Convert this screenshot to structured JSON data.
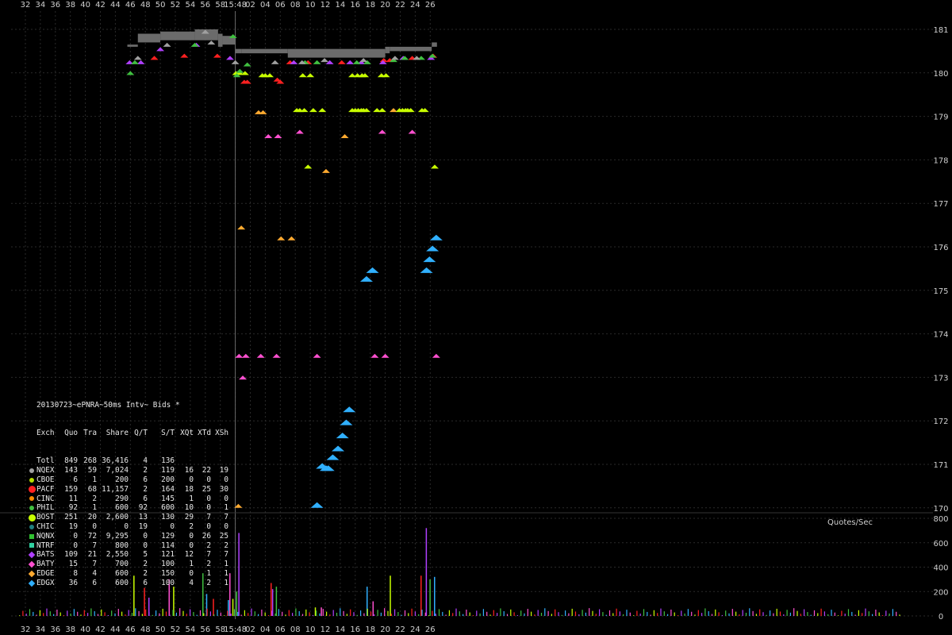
{
  "chart_data": {
    "type": "scatter",
    "x_ticks": [
      "32",
      "34",
      "36",
      "38",
      "40",
      "42",
      "44",
      "46",
      "48",
      "50",
      "52",
      "54",
      "56",
      "58",
      "15:48",
      "02",
      "04",
      "06",
      "08",
      "10",
      "12",
      "14",
      "16",
      "18",
      "20",
      "22",
      "24",
      "26"
    ],
    "y_ticks": [
      "181",
      "180",
      "179",
      "178",
      "177",
      "176",
      "175",
      "174",
      "173",
      "172",
      "171",
      "170"
    ],
    "ylim": [
      170,
      181
    ],
    "volume_ticks": [
      "800",
      "600",
      "400",
      "200",
      "0"
    ],
    "volume_label": "Quotes/Sec",
    "legend_title": "20130723~ePNRA~50ms Intv~ Bids *",
    "legend_header": [
      "Exch",
      "Quo",
      "Tra",
      "Share",
      "Q/T",
      "S/T",
      "XQt",
      "XTd",
      "XSh"
    ],
    "legend_rows": [
      {
        "name": "Totl",
        "cells": [
          "849",
          "268",
          "36,416",
          "4",
          "136",
          "",
          "",
          ""
        ],
        "color": ""
      },
      {
        "name": "NQEX",
        "cells": [
          "143",
          "59",
          "7,024",
          "2",
          "119",
          "16",
          "22",
          "19"
        ],
        "color": "#a0a0a0"
      },
      {
        "name": "CBOE",
        "cells": [
          "6",
          "1",
          "200",
          "6",
          "200",
          "0",
          "0",
          "0"
        ],
        "color": "#b8e000"
      },
      {
        "name": "PACF",
        "cells": [
          "159",
          "68",
          "11,157",
          "2",
          "164",
          "18",
          "25",
          "30"
        ],
        "color": "#ff2020"
      },
      {
        "name": "CINC",
        "cells": [
          "11",
          "2",
          "290",
          "6",
          "145",
          "1",
          "0",
          "0"
        ],
        "color": "#ff8c00"
      },
      {
        "name": "PHIL",
        "cells": [
          "92",
          "1",
          "600",
          "92",
          "600",
          "10",
          "0",
          "1"
        ],
        "color": "#40c040"
      },
      {
        "name": "BOST",
        "cells": [
          "251",
          "20",
          "2,600",
          "13",
          "130",
          "29",
          "7",
          "7"
        ],
        "color": "#c8ff00"
      },
      {
        "name": "CHIC",
        "cells": [
          "19",
          "0",
          "0",
          "19",
          "0",
          "2",
          "0",
          "0"
        ],
        "color": "#208080"
      },
      {
        "name": "NQNX",
        "cells": [
          "0",
          "72",
          "9,295",
          "0",
          "129",
          "0",
          "26",
          "25"
        ],
        "color": "#30c030"
      },
      {
        "name": "NTRF",
        "cells": [
          "0",
          "7",
          "800",
          "0",
          "114",
          "0",
          "2",
          "2"
        ],
        "color": "#30d0a0"
      },
      {
        "name": "BATS",
        "cells": [
          "109",
          "21",
          "2,550",
          "5",
          "121",
          "12",
          "7",
          "7"
        ],
        "color": "#b040ff"
      },
      {
        "name": "BATY",
        "cells": [
          "15",
          "7",
          "700",
          "2",
          "100",
          "1",
          "2",
          "1"
        ],
        "color": "#ff50d0"
      },
      {
        "name": "EDGE",
        "cells": [
          "8",
          "4",
          "600",
          "2",
          "150",
          "0",
          "1",
          "1"
        ],
        "color": "#ffaa30"
      },
      {
        "name": "EDGX",
        "cells": [
          "36",
          "6",
          "600",
          "6",
          "100",
          "4",
          "2",
          "1"
        ],
        "color": "#30b0ff"
      }
    ],
    "series": [
      {
        "name": "EDGX",
        "color": "#30b0ff",
        "points": [
          [
            10.9,
            170.0
          ],
          [
            11.6,
            170.9
          ],
          [
            12.1,
            170.85
          ],
          [
            12.4,
            170.85
          ],
          [
            13.0,
            171.1
          ],
          [
            13.7,
            171.3
          ],
          [
            14.3,
            171.6
          ],
          [
            14.8,
            171.9
          ],
          [
            15.2,
            172.2
          ],
          [
            17.5,
            175.2
          ],
          [
            18.3,
            175.4
          ],
          [
            25.5,
            175.4
          ],
          [
            25.9,
            175.65
          ],
          [
            26.3,
            175.9
          ],
          [
            26.8,
            176.15
          ]
        ]
      },
      {
        "name": "EDGE",
        "color": "#ffaa30",
        "points": [
          [
            0.4,
            170.0
          ],
          [
            0.8,
            176.4
          ],
          [
            6.1,
            176.15
          ],
          [
            7.5,
            176.15
          ],
          [
            12.1,
            177.7
          ],
          [
            14.6,
            178.5
          ],
          [
            3.1,
            179.05
          ],
          [
            3.7,
            179.05
          ],
          [
            21.1,
            179.1
          ]
        ]
      },
      {
        "name": "BATY",
        "color": "#ff50d0",
        "points": [
          [
            0.5,
            173.45
          ],
          [
            1.4,
            173.45
          ],
          [
            3.4,
            173.45
          ],
          [
            5.5,
            173.45
          ],
          [
            10.9,
            173.45
          ],
          [
            18.6,
            173.45
          ],
          [
            20.0,
            173.45
          ],
          [
            26.8,
            173.45
          ],
          [
            1.0,
            172.95
          ],
          [
            4.4,
            178.5
          ],
          [
            5.7,
            178.5
          ],
          [
            8.6,
            178.6
          ],
          [
            19.6,
            178.6
          ],
          [
            23.6,
            178.6
          ]
        ]
      },
      {
        "name": "BOST",
        "color": "#c8ff00",
        "points": [
          [
            9.7,
            177.8
          ],
          [
            26.6,
            177.8
          ],
          [
            8.2,
            179.1
          ],
          [
            8.6,
            179.1
          ],
          [
            9.2,
            179.1
          ],
          [
            10.4,
            179.1
          ],
          [
            11.6,
            179.1
          ],
          [
            15.6,
            179.1
          ],
          [
            16.0,
            179.1
          ],
          [
            16.4,
            179.1
          ],
          [
            16.8,
            179.1
          ],
          [
            17.1,
            179.1
          ],
          [
            17.5,
            179.1
          ],
          [
            18.9,
            179.1
          ],
          [
            19.6,
            179.1
          ],
          [
            21.9,
            179.1
          ],
          [
            22.3,
            179.1
          ],
          [
            22.7,
            179.1
          ],
          [
            23.0,
            179.1
          ],
          [
            23.4,
            179.1
          ],
          [
            24.9,
            179.1
          ],
          [
            25.3,
            179.1
          ],
          [
            3.6,
            179.9
          ],
          [
            4.0,
            179.9
          ],
          [
            4.6,
            179.9
          ],
          [
            9.0,
            179.9
          ],
          [
            10.0,
            179.9
          ],
          [
            15.6,
            179.9
          ],
          [
            16.3,
            179.9
          ],
          [
            16.9,
            179.9
          ],
          [
            17.3,
            179.9
          ],
          [
            19.5,
            179.9
          ],
          [
            20.1,
            179.9
          ],
          [
            0.1,
            179.95
          ],
          [
            0.6,
            179.95
          ],
          [
            1.3,
            179.95
          ]
        ]
      },
      {
        "name": "PACF",
        "color": "#ff2020",
        "points": [
          [
            1.2,
            179.75
          ],
          [
            1.6,
            179.75
          ],
          [
            5.6,
            179.8
          ],
          [
            6.0,
            179.75
          ],
          [
            7.3,
            180.2
          ],
          [
            9.7,
            180.2
          ],
          [
            14.2,
            180.2
          ],
          [
            19.8,
            180.25
          ],
          [
            20.6,
            180.25
          ],
          [
            23.6,
            180.3
          ],
          [
            26.4,
            180.35
          ],
          [
            -10.8,
            180.3
          ],
          [
            -6.8,
            180.35
          ],
          [
            -2.4,
            180.35
          ]
        ]
      },
      {
        "name": "BATS",
        "color": "#b040ff",
        "points": [
          [
            -14.1,
            180.2
          ],
          [
            -12.6,
            180.2
          ],
          [
            -10.0,
            180.5
          ],
          [
            -5.2,
            180.6
          ],
          [
            -0.7,
            180.3
          ],
          [
            7.8,
            180.2
          ],
          [
            12.6,
            180.2
          ],
          [
            15.3,
            180.2
          ],
          [
            16.8,
            180.2
          ],
          [
            19.7,
            180.2
          ],
          [
            22.4,
            180.3
          ],
          [
            26.1,
            180.3
          ]
        ]
      },
      {
        "name": "PHIL",
        "color": "#40c040",
        "points": [
          [
            -14.0,
            179.95
          ],
          [
            -13.4,
            180.2
          ],
          [
            -5.4,
            180.6
          ],
          [
            -0.3,
            180.8
          ],
          [
            0.2,
            179.9
          ],
          [
            0.6,
            180.0
          ],
          [
            1.6,
            180.15
          ],
          [
            9.3,
            180.2
          ],
          [
            10.9,
            180.2
          ],
          [
            16.2,
            180.2
          ],
          [
            17.6,
            180.2
          ],
          [
            21.1,
            180.25
          ],
          [
            22.6,
            180.3
          ],
          [
            24.8,
            180.3
          ],
          [
            26.3,
            180.35
          ]
        ]
      },
      {
        "name": "NQEX",
        "color": "#a0a0a0",
        "points": [
          [
            -13.0,
            180.3
          ],
          [
            -9.1,
            180.6
          ],
          [
            -4.0,
            180.9
          ],
          [
            -3.2,
            180.65
          ],
          [
            0.0,
            180.2
          ],
          [
            5.3,
            180.2
          ],
          [
            8.9,
            180.2
          ],
          [
            11.9,
            180.25
          ],
          [
            17.1,
            180.25
          ],
          [
            21.3,
            180.3
          ],
          [
            24.2,
            180.3
          ]
        ]
      }
    ],
    "nbbo_segments": [
      [
        -14.4,
        180.6,
        -13.0,
        180.65
      ],
      [
        -13.0,
        180.7,
        -10.0,
        180.9
      ],
      [
        -10.0,
        180.75,
        -8.0,
        180.95
      ],
      [
        -8.0,
        180.75,
        -5.4,
        180.95
      ],
      [
        -5.4,
        180.75,
        -2.3,
        181.0
      ],
      [
        -2.3,
        180.6,
        -1.7,
        180.9
      ],
      [
        -1.7,
        180.65,
        0.0,
        180.85
      ],
      [
        0.0,
        180.45,
        0.8,
        180.55
      ],
      [
        0.8,
        180.45,
        7.0,
        180.55
      ],
      [
        7.0,
        180.35,
        20.0,
        180.55
      ],
      [
        20.0,
        180.45,
        20.6,
        180.6
      ],
      [
        20.6,
        180.5,
        26.2,
        180.6
      ],
      [
        26.2,
        180.6,
        26.9,
        180.7
      ]
    ],
    "volume": {
      "peaks": [
        [
          -13.6,
          330
        ],
        [
          -12.2,
          230
        ],
        [
          -11.6,
          150
        ],
        [
          -4.4,
          350
        ],
        [
          -3.9,
          180
        ],
        [
          -0.8,
          350
        ],
        [
          -0.4,
          140
        ],
        [
          4.7,
          270
        ],
        [
          4.9,
          220
        ],
        [
          5.4,
          240
        ],
        [
          -1.0,
          130
        ],
        [
          -8.9,
          300
        ],
        [
          -8.3,
          240
        ],
        [
          -3.0,
          140
        ],
        [
          0.4,
          680
        ],
        [
          0.1,
          200
        ],
        [
          17.5,
          240
        ],
        [
          18.3,
          120
        ],
        [
          20.6,
          330
        ],
        [
          24.7,
          330
        ],
        [
          25.4,
          720
        ],
        [
          25.9,
          300
        ],
        [
          26.5,
          320
        ],
        [
          11.4,
          70
        ],
        [
          10.6,
          70
        ]
      ]
    }
  }
}
